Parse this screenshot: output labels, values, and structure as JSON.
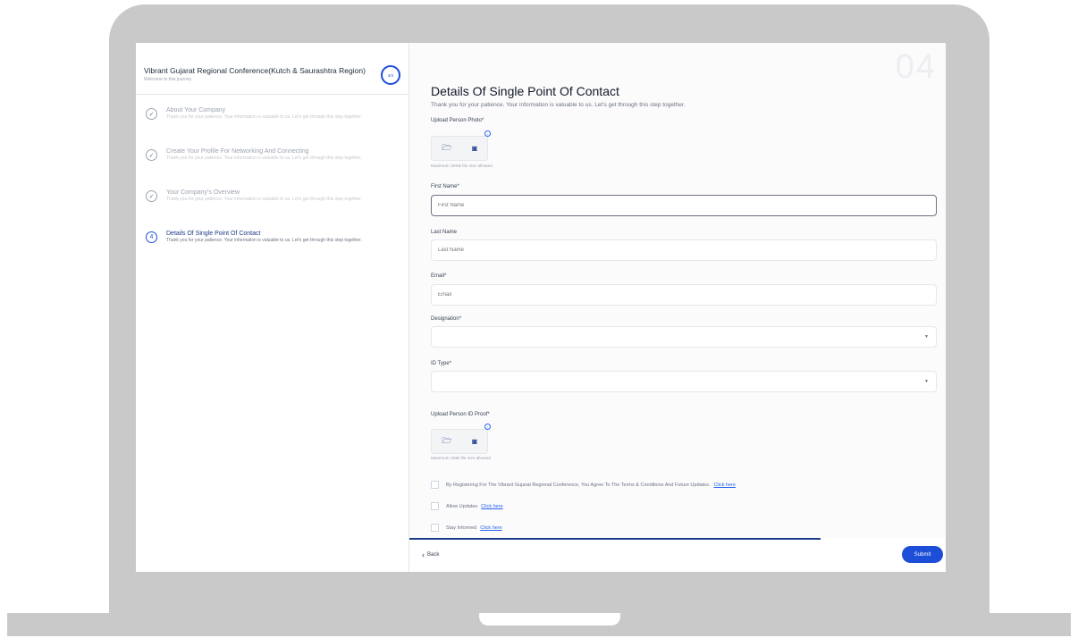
{
  "sidebar": {
    "title": "Vibrant Gujarat Regional Conference(Kutch & Saurashtra Region)",
    "subtitle": "Welcome to this journey",
    "progress": "4/4",
    "steps": [
      {
        "number": "1",
        "title": "About Your Company",
        "description": "Thank you for your patience. Your information is valuable to us. Let's get through this step together.",
        "status": "completed"
      },
      {
        "number": "2",
        "title": "Create Your Profile For Networking And Connecting",
        "description": "Thank you for your patience. Your information is valuable to us. Let's get through this step together.",
        "status": "completed"
      },
      {
        "number": "3",
        "title": "Your Company's Overview",
        "description": "Thank you for your patience. Your information is valuable to us. Let's get through this step together.",
        "status": "completed"
      },
      {
        "number": "4",
        "title": "Details Of Single Point Of Contact",
        "description": "Thank you for your patience. Your information is valuable to us. Let's get through this step together.",
        "status": "active"
      }
    ]
  },
  "main": {
    "step_number": "04",
    "title": "Details Of Single Point Of Contact",
    "subtitle": "Thank you for your patience. Your information is valuable to us. Let's get through this step together.",
    "photo": {
      "label": "Upload Person Photo*",
      "hint": "Maximum 30KB file size allowed"
    },
    "first_name": {
      "label": "First Name*",
      "placeholder": "First Name"
    },
    "last_name": {
      "label": "Last Name",
      "placeholder": "Last Name"
    },
    "email": {
      "label": "Email*",
      "placeholder": "Email"
    },
    "designation": {
      "label": "Designation*",
      "value": ""
    },
    "id_type": {
      "label": "ID Type*",
      "value": ""
    },
    "id_proof": {
      "label": "Upload Person ID Proof*",
      "hint": "Maximum 2MB file size allowed"
    },
    "checkboxes": [
      {
        "text": "By Registering For The Vibrant Gujarat Regional Conference, You Agree To The Terms & Conditions And Future Updates.",
        "link": "Click here",
        "checked": false
      },
      {
        "text": "Allow Updates",
        "link": "Click here",
        "checked": false
      },
      {
        "text": "Stay Informed",
        "link": "Click here",
        "checked": false
      }
    ]
  },
  "footer": {
    "back_label": "Back",
    "submit_label": "Submit"
  },
  "colors": {
    "primary": "#1d4ed8",
    "frame": "#c9c9c9",
    "title": "#111827"
  }
}
